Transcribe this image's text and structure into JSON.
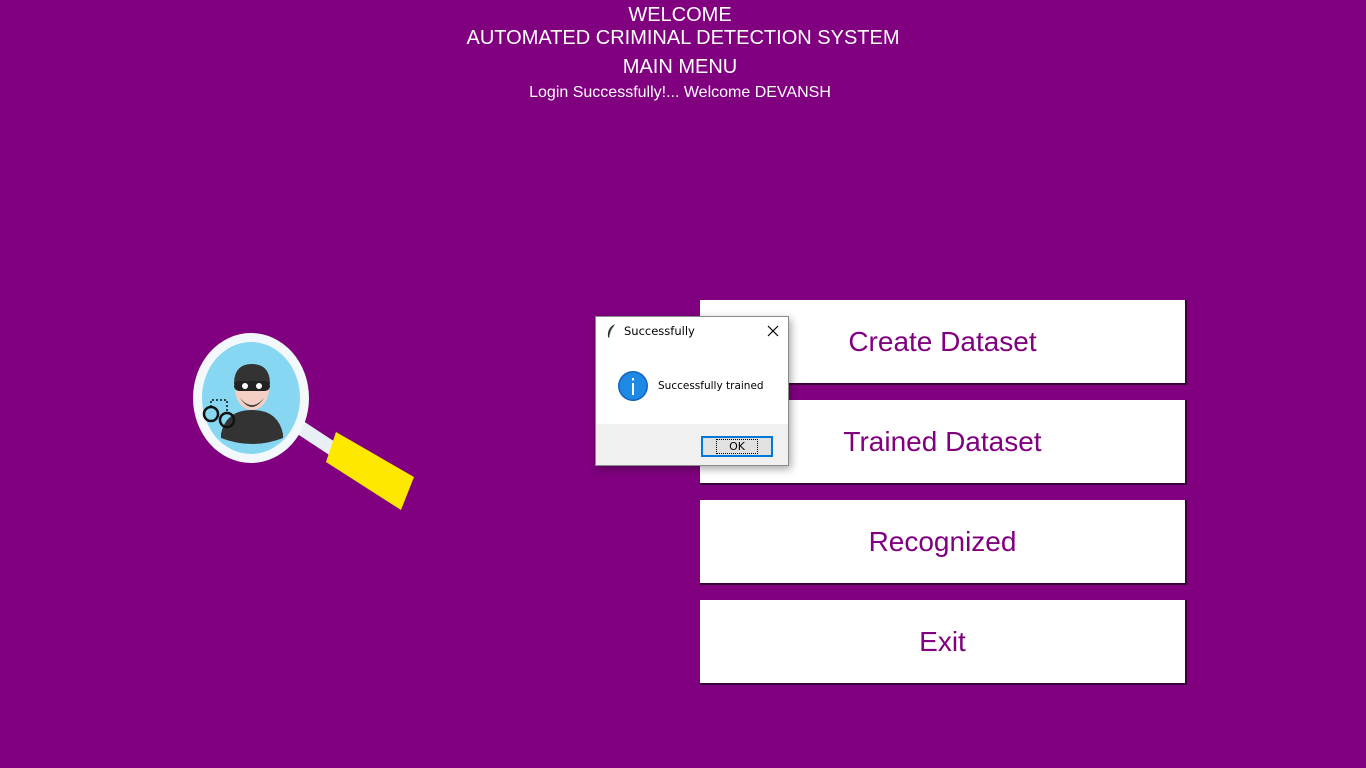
{
  "header": {
    "welcome": "WELCOME",
    "system_title": "AUTOMATED CRIMINAL DETECTION SYSTEM",
    "menu_title": "MAIN MENU",
    "login_message": "Login Successfully!... Welcome DEVANSH"
  },
  "menu": {
    "create_dataset": "Create Dataset",
    "trained_dataset": "Trained Dataset",
    "recognized": "Recognized",
    "exit": "Exit"
  },
  "logo": {
    "icon": "magnifier-criminal-logo"
  },
  "dialog": {
    "title": "Successfully",
    "message": "Successfully trained",
    "ok_label": "OK",
    "icon": "info-icon"
  },
  "colors": {
    "background": "#800080",
    "button_bg": "#ffffff",
    "button_text": "#800080",
    "header_text": "#ffffff"
  }
}
